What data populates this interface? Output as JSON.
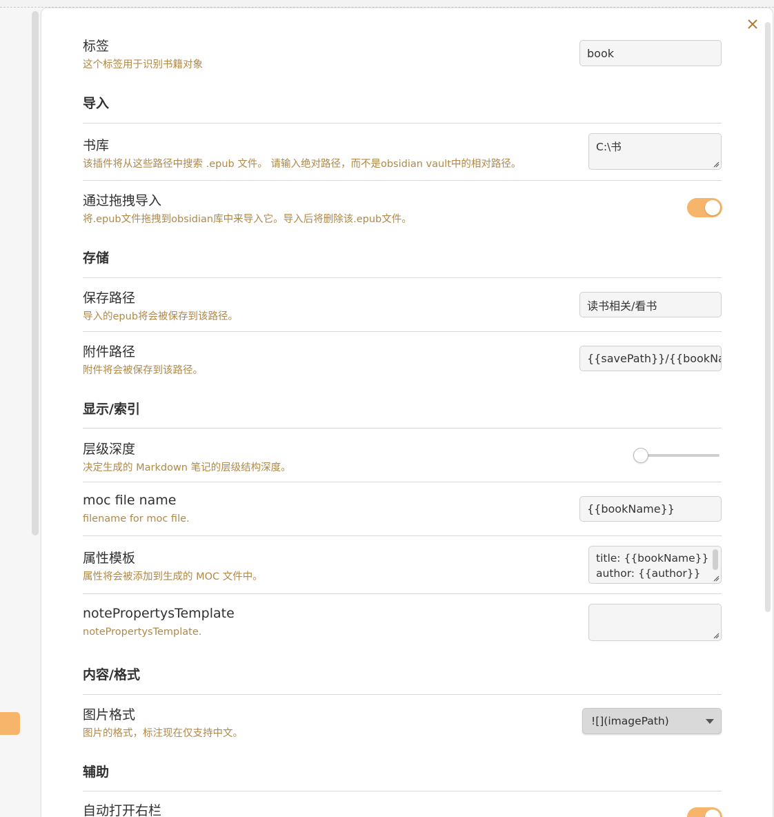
{
  "colors": {
    "accent": "#f6b56a",
    "description": "#b08848"
  },
  "close_icon": "close-icon",
  "settings": {
    "tag": {
      "name": "标签",
      "desc": "这个标签用于识别书籍对象",
      "value": "book"
    },
    "import_heading": "导入",
    "library": {
      "name": "书库",
      "desc": "该插件将从这些路径中搜索 .epub 文件。 请输入绝对路径，而不是obsidian vault中的相对路径。",
      "value": "C:\\书"
    },
    "drag_import": {
      "name": "通过拖拽导入",
      "desc": "将.epub文件拖拽到obsidian库中来导入它。导入后将删除该.epub文件。",
      "enabled": true
    },
    "storage_heading": "存储",
    "save_path": {
      "name": "保存路径",
      "desc": "导入的epub将会被保存到该路径。",
      "value": "读书相关/看书"
    },
    "attachment_path": {
      "name": "附件路径",
      "desc": "附件将会被保存到该路径。",
      "value": "{{savePath}}/{{bookName}}"
    },
    "display_heading": "显示/索引",
    "level_depth": {
      "name": "层级深度",
      "desc": "决定生成的 Markdown 笔记的层级结构深度。",
      "level": 0
    },
    "moc_file_name": {
      "name": "moc file name",
      "desc": "filename for moc file.",
      "value": "{{bookName}}"
    },
    "property_template": {
      "name": "属性模板",
      "desc": "属性将会被添加到生成的 MOC 文件中。",
      "line1": "title: {{bookName}}",
      "line2": "author: {{author}}"
    },
    "note_properties_template": {
      "name": "notePropertysTemplate",
      "desc": "notePropertysTemplate.",
      "value": ""
    },
    "content_heading": "内容/格式",
    "image_format": {
      "name": "图片格式",
      "desc": "图片的格式，标注现在仅支持中文。",
      "selected": "![](imagePath)"
    },
    "assist_heading": "辅助",
    "auto_open_sidebar": {
      "name": "自动打开右栏",
      "enabled": true
    }
  }
}
